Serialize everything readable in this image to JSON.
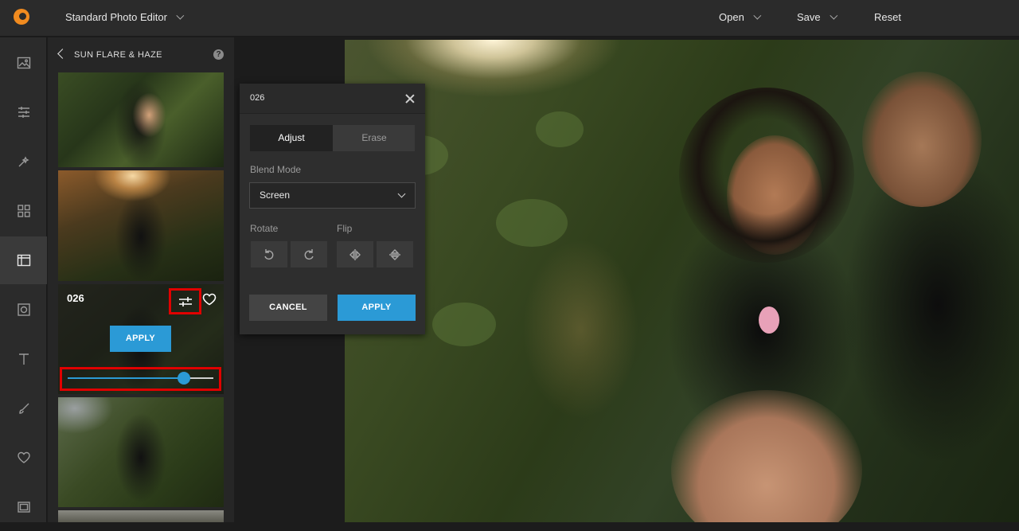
{
  "app": {
    "title": "Standard Photo Editor"
  },
  "topbar": {
    "open_label": "Open",
    "save_label": "Save",
    "reset_label": "Reset"
  },
  "rail": {
    "items": [
      {
        "icon": "image-icon",
        "active": false
      },
      {
        "icon": "adjust-sliders-icon",
        "active": false
      },
      {
        "icon": "magic-wand-icon",
        "active": false
      },
      {
        "icon": "grid-icon",
        "active": false
      },
      {
        "icon": "effects-panel-icon",
        "active": true
      },
      {
        "icon": "frame-icon",
        "active": false
      },
      {
        "icon": "text-icon",
        "active": false
      },
      {
        "icon": "brush-icon",
        "active": false
      },
      {
        "icon": "heart-icon",
        "active": false
      },
      {
        "icon": "border-icon",
        "active": false
      }
    ]
  },
  "panel": {
    "title": "SUN FLARE & HAZE",
    "help": "?",
    "selected_item": {
      "number": "026",
      "apply_label": "APPLY",
      "slider_value": 0.8
    }
  },
  "dialog": {
    "title": "026",
    "tabs": [
      "Adjust",
      "Erase"
    ],
    "active_tab": "Adjust",
    "blend_mode_label": "Blend Mode",
    "blend_mode_value": "Screen",
    "rotate_label": "Rotate",
    "flip_label": "Flip",
    "cancel_label": "CANCEL",
    "apply_label": "APPLY"
  },
  "colors": {
    "accent": "#2b9ad6",
    "highlight": "#e00000",
    "brand": "#f18b1f"
  }
}
